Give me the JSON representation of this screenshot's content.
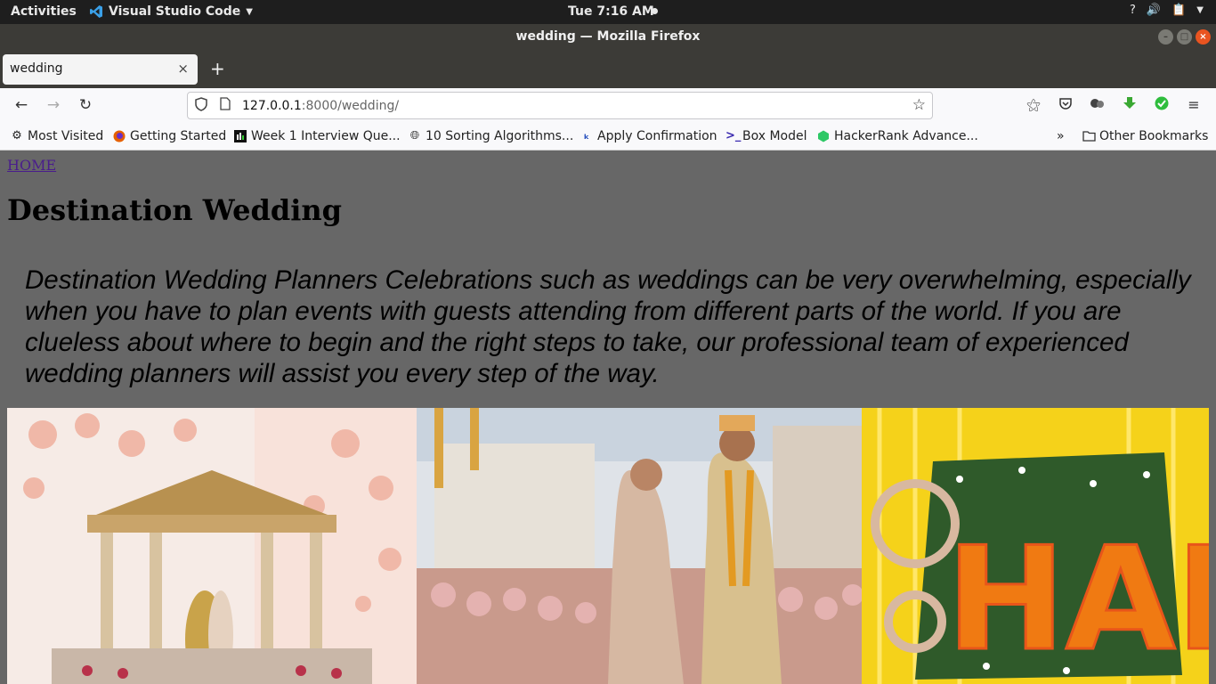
{
  "system_bar": {
    "activities": "Activities",
    "app_name": "Visual Studio Code",
    "clock": "Tue  7:16 AM",
    "tray_icons": [
      "help-icon",
      "volume-icon",
      "clipboard-icon",
      "power-menu-icon"
    ]
  },
  "window": {
    "title": "wedding — Mozilla Firefox"
  },
  "tabs": [
    {
      "label": "wedding",
      "close": "×"
    }
  ],
  "new_tab": "+",
  "nav": {
    "url_host": "127.0.0.1",
    "url_rest": ":8000/wedding/"
  },
  "bookmarks": [
    {
      "label": "Most Visited",
      "icon": "gear-icon"
    },
    {
      "label": "Getting Started",
      "icon": "firefox-icon"
    },
    {
      "label": "Week 1 Interview Que...",
      "icon": "black-square-icon"
    },
    {
      "label": "10 Sorting Algorithms...",
      "icon": "globe-icon"
    },
    {
      "label": "Apply Confirmation",
      "icon": "blue-c-icon"
    },
    {
      "label": "Box Model",
      "icon": "prompt-icon"
    },
    {
      "label": "HackerRank Advance...",
      "icon": "hackerrank-icon"
    }
  ],
  "other_bookmarks": "Other Bookmarks",
  "page": {
    "home_link": "HOME",
    "heading": "Destination Wedding",
    "paragraph": "Destination Wedding Planners Celebrations such as weddings can be very overwhelming, especially when you have to plan events with guests attending from different parts of the world. If you are clueless about where to begin and the right steps to take, our professional team of experienced wedding planners will assist you every step of the way.",
    "photos": [
      {
        "name": "gazebo-wedding-photo"
      },
      {
        "name": "couple-ceremony-photo"
      },
      {
        "name": "haldi-flower-photo",
        "text": "HALDI"
      }
    ]
  },
  "colors": {
    "page_background": "#676767",
    "link": "#4a1d8c",
    "titlebar": "#3c3b37"
  }
}
